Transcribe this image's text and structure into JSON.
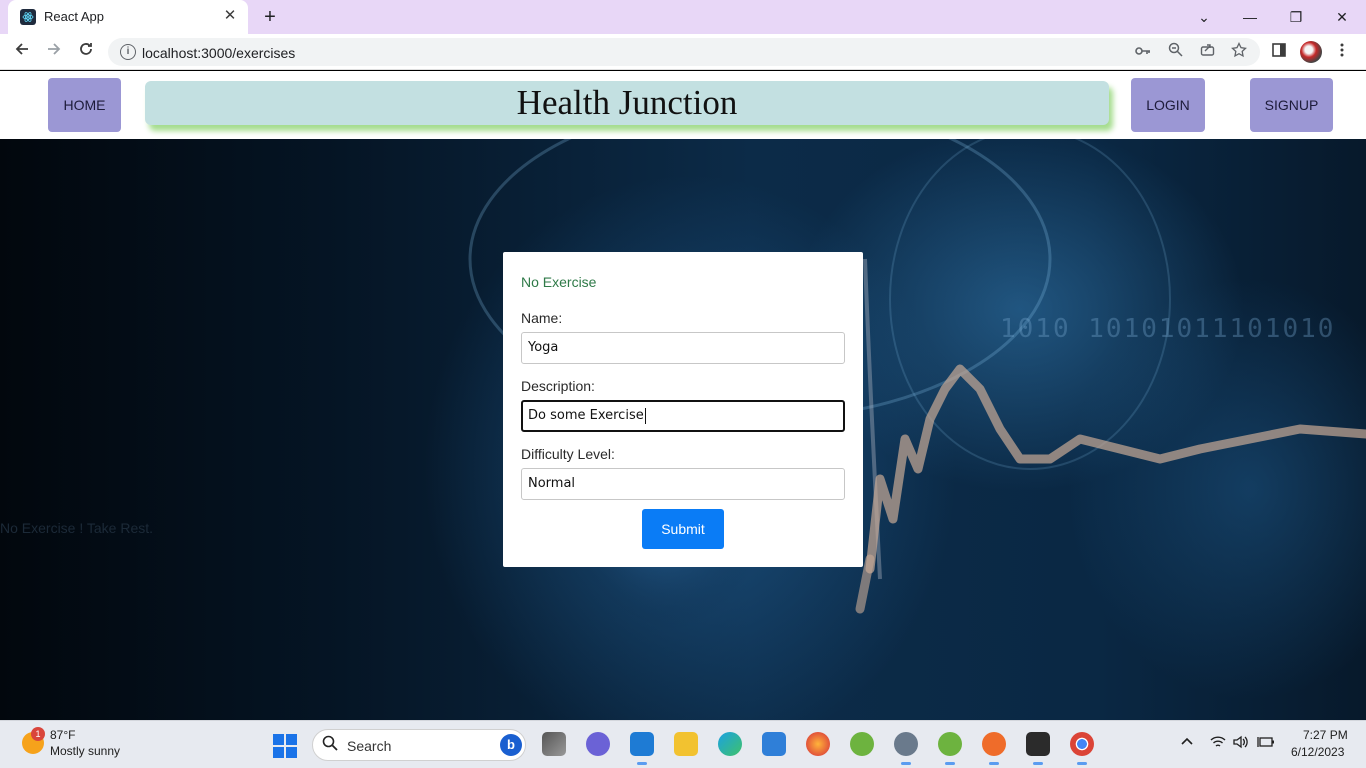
{
  "browser": {
    "tab_title": "React App",
    "url": "localhost:3000/exercises",
    "tab_close": "✕",
    "new_tab": "+",
    "window_controls": [
      "⌄",
      "—",
      "❐",
      "✕"
    ]
  },
  "header": {
    "home_label": "HOME",
    "site_title": "Health Junction",
    "login_label": "LOGIN",
    "signup_label": "SIGNUP"
  },
  "hero": {
    "binary_text": "1010   10101011101010",
    "aside_text": "No Exercise ! Take Rest."
  },
  "form": {
    "status": "No Exercise",
    "name_label": "Name:",
    "name_value": "Yoga",
    "description_label": "Description:",
    "description_value": "Do some Exercise",
    "difficulty_label": "Difficulty Level:",
    "difficulty_value": "Normal",
    "submit_label": "Submit"
  },
  "taskbar": {
    "weather_badge": "1",
    "weather_temp": "87°F",
    "weather_desc": "Mostly sunny",
    "search_label": "Search",
    "time": "7:27 PM",
    "date": "6/12/2023",
    "apps": [
      "file-explorer-tasks",
      "teams",
      "vscode",
      "folder",
      "edge",
      "store",
      "firefox",
      "spring-tool",
      "settings",
      "spring-tool-2",
      "postman",
      "terminal",
      "chrome"
    ]
  },
  "colors": {
    "nav_button": "#9b97d4",
    "title_bar": "#c3e0e1",
    "title_shadow": "#a5dd8e",
    "status_text": "#2f7a48",
    "submit_button": "#0a7cf6",
    "tabbar": "#e8d7f7"
  }
}
